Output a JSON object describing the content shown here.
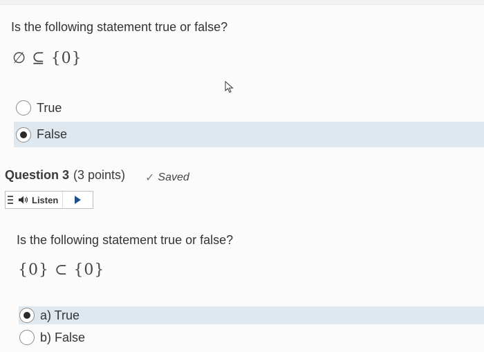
{
  "q2": {
    "prompt": "Is the following statement true or false?",
    "expression": "∅ ⊆ {0}",
    "options": [
      {
        "label": "True",
        "selected": false
      },
      {
        "label": "False",
        "selected": true
      }
    ]
  },
  "q3": {
    "title": "Question 3",
    "points": "(3 points)",
    "saved": "Saved",
    "listen_label": "Listen",
    "prompt": "Is the following statement true or false?",
    "expression": "{0} ⊂ {0}",
    "options": [
      {
        "label": "a) True",
        "selected": true
      },
      {
        "label": "b) False",
        "selected": false
      }
    ]
  },
  "colors": {
    "selected_row": "#dfe8ef",
    "play_button": "#1f4e8c"
  }
}
